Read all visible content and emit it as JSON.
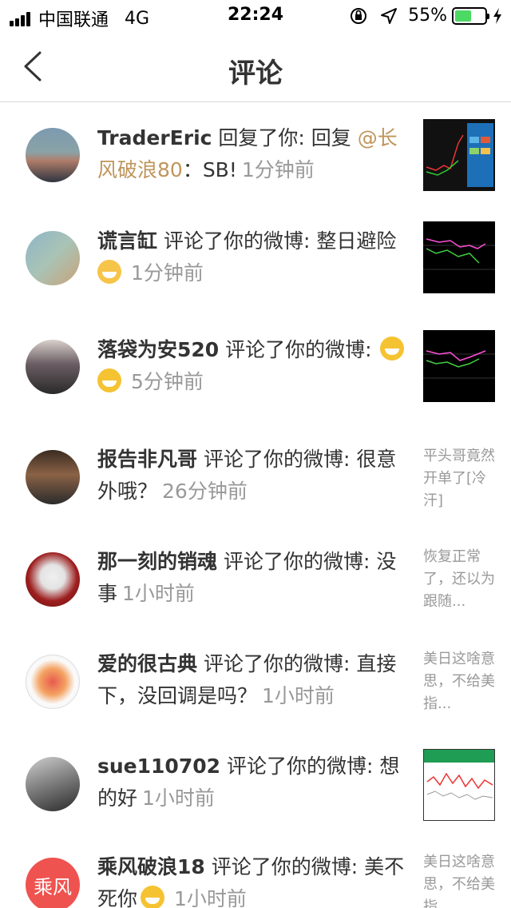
{
  "status_bar": {
    "carrier": "中国联通",
    "network": "4G",
    "time": "22:24",
    "battery": "55%",
    "battery_level": 0.55
  },
  "nav": {
    "title": "评论"
  },
  "comments": [
    {
      "user": "TraderEric",
      "action": " 回复了你: 回复 ",
      "mention": "@长风破浪80",
      "text": "：SB!",
      "time": "1分钟前",
      "thumb": "chart"
    },
    {
      "user": "谎言缸",
      "action": " 评论了你的微博: ",
      "text": "整日避险",
      "time": "1分钟前",
      "emoji": "crying-emoji",
      "thumb": "chart"
    },
    {
      "user": "落袋为安520",
      "action": " 评论了你的微博: ",
      "text": "",
      "time": "5分钟前",
      "emoji": "grin-emoji-x2",
      "thumb": "chart"
    },
    {
      "user": "报告非凡哥",
      "action": " 评论了你的微博: ",
      "text": "很意外哦？",
      "time": "26分钟前",
      "quote": "平头哥竟然开单了[冷汗]"
    },
    {
      "user": "那一刻的销魂",
      "action": " 评论了你的微博: ",
      "text": "没事",
      "time": "1小时前",
      "quote": "恢复正常了，还以为跟随..."
    },
    {
      "user": "爱的很古典",
      "action": " 评论了你的微博: ",
      "text": "直接下，没回调是吗？",
      "time": "1小时前",
      "quote": "美日这啥意思，不给美指..."
    },
    {
      "user": "sue110702",
      "action": " 评论了你的微博: ",
      "text": "想的好",
      "time": "1小时前",
      "thumb": "chart"
    },
    {
      "user": "乘风破浪18",
      "action": " 评论了你的微博: ",
      "text": "美不死你",
      "time": "1小时前",
      "quote": "美日这啥意思，不给美指...",
      "avatar_text": "乘风"
    }
  ]
}
